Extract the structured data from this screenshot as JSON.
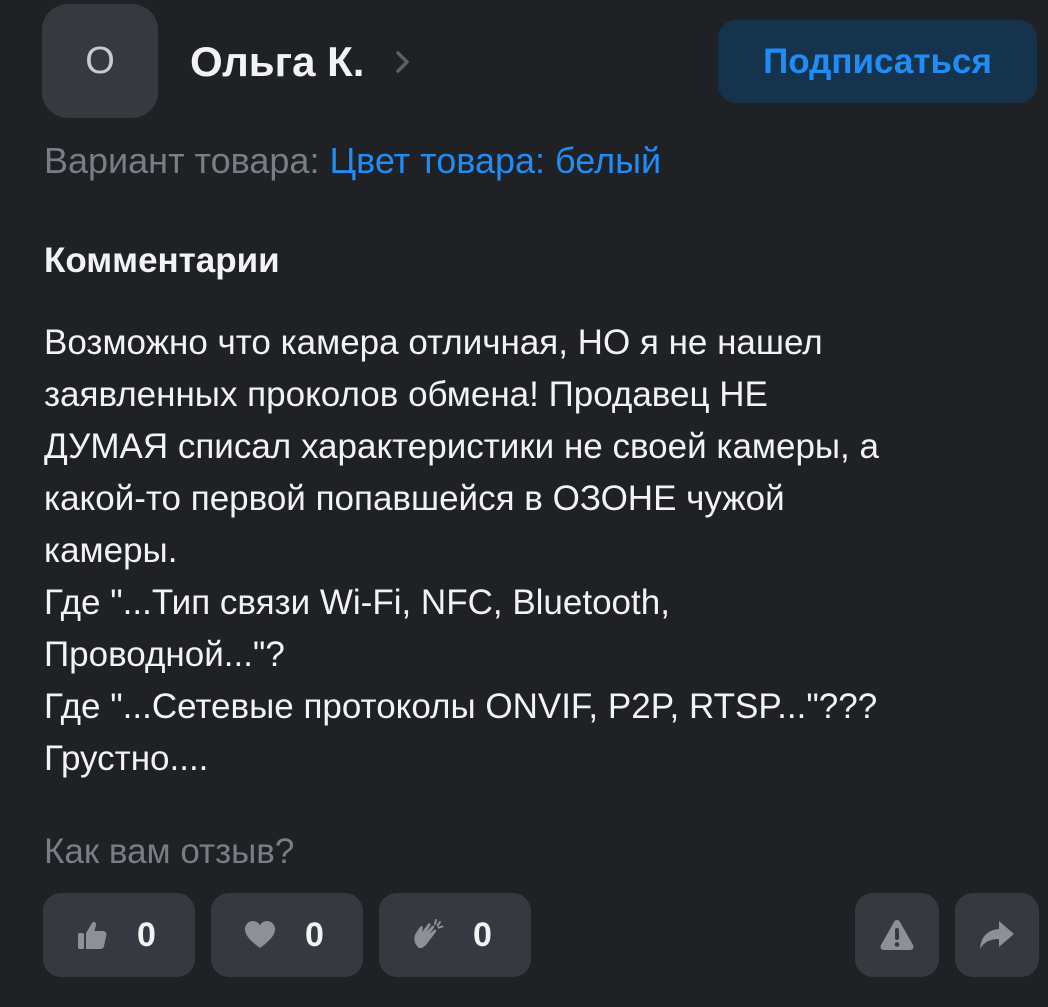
{
  "author": {
    "avatar_initial": "О",
    "name": "Ольга К.",
    "chevron_icon": "chevron-right-icon"
  },
  "subscribe": {
    "label": "Подписаться"
  },
  "variant": {
    "label": "Вариант товара:",
    "value": "Цвет товара: белый"
  },
  "comments": {
    "heading": "Комментарии",
    "lines": [
      "Возможно что камера отличная, НО я не нашел",
      "заявленных проколов обмена! Продавец НЕ",
      "ДУМАЯ списал характеристики не своей камеры, а",
      "какой-то первой попавшейся в ОЗОНЕ чужой",
      "камеры.",
      "Где \"...Тип связи Wi-Fi, NFC, Bluetooth,",
      "Проводной...\"?",
      "Где \"...Сетевые протоколы ONVIF, P2P, RTSP...\"???",
      "Грустно...."
    ]
  },
  "rating": {
    "question": "Как вам отзыв?",
    "reactions": {
      "like": {
        "icon": "thumbs-up-icon",
        "count": "0"
      },
      "heart": {
        "icon": "heart-icon",
        "count": "0"
      },
      "clap": {
        "icon": "clap-icon",
        "count": "0"
      }
    },
    "report_icon": "warning-icon",
    "share_icon": "share-icon"
  },
  "colors": {
    "background": "#1f2125",
    "button_bg": "#36393f",
    "accent": "#1f8df5",
    "subscribe_bg": "#15334d",
    "muted_text": "#787d86",
    "text": "#f2f3f5"
  }
}
